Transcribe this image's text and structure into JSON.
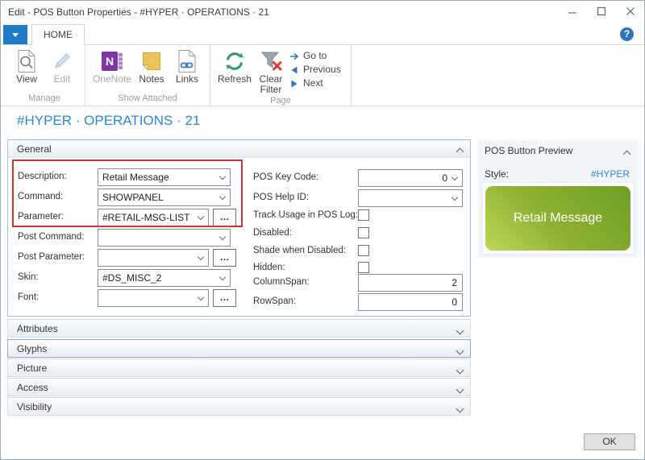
{
  "window": {
    "title": "Edit - POS Button Properties - #HYPER · OPERATIONS · 21"
  },
  "ribbon": {
    "tab": "HOME",
    "help_glyph": "?",
    "groups": [
      {
        "label": "Manage",
        "buttons": [
          {
            "label": "View"
          },
          {
            "label": "Edit"
          }
        ]
      },
      {
        "label": "Show Attached",
        "buttons": [
          {
            "label": "OneNote"
          },
          {
            "label": "Notes"
          },
          {
            "label": "Links"
          }
        ]
      },
      {
        "label": "Page",
        "buttons": [
          {
            "label": "Refresh"
          },
          {
            "label": "Clear Filter"
          }
        ],
        "menu": [
          {
            "label": "Go to"
          },
          {
            "label": "Previous"
          },
          {
            "label": "Next"
          }
        ]
      }
    ]
  },
  "page": {
    "title": "#HYPER · OPERATIONS · 21"
  },
  "general": {
    "title": "General",
    "left_fields": [
      {
        "label": "Description:",
        "value": "Retail Message"
      },
      {
        "label": "Command:",
        "value": "SHOWPANEL"
      },
      {
        "label": "Parameter:",
        "value": "#RETAIL-MSG-LIST"
      },
      {
        "label": "Post Command:",
        "value": ""
      },
      {
        "label": "Post Parameter:",
        "value": ""
      },
      {
        "label": "Skin:",
        "value": "#DS_MISC_2"
      },
      {
        "label": "Font:",
        "value": ""
      }
    ],
    "right_fields": [
      {
        "label": "POS Key Code:",
        "value": "0"
      },
      {
        "label": "POS Help ID:",
        "value": ""
      },
      {
        "label": "Track Usage in POS Log:",
        "checked": false
      },
      {
        "label": "Disabled:",
        "checked": false
      },
      {
        "label": "Shade when Disabled:",
        "checked": false
      },
      {
        "label": "Hidden:",
        "checked": false
      },
      {
        "label": "ColumnSpan:",
        "value": "2"
      },
      {
        "label": "RowSpan:",
        "value": "0"
      }
    ]
  },
  "sections": [
    {
      "label": "Attributes"
    },
    {
      "label": "Glyphs"
    },
    {
      "label": "Picture"
    },
    {
      "label": "Access"
    },
    {
      "label": "Visibility"
    }
  ],
  "preview": {
    "title": "POS Button Preview",
    "style_label": "Style:",
    "style_value": "#HYPER",
    "button_text": "Retail Message"
  },
  "footer": {
    "ok_label": "OK"
  },
  "glyphs": {
    "ellipsis": "…"
  },
  "colors": {
    "accent_blue": "#1e7bc9",
    "title_blue": "#2e86d4",
    "highlight_red": "#cb3632",
    "preview_green_dark": "#6f9d26",
    "preview_green_light": "#bcd857"
  }
}
